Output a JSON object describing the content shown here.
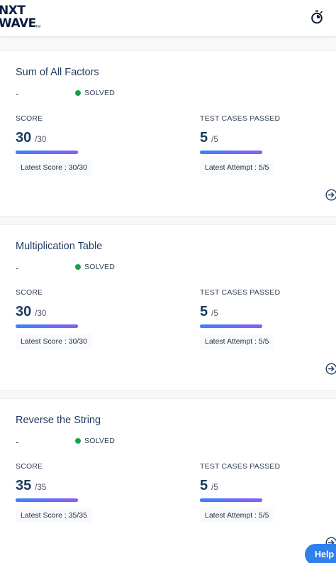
{
  "app": {
    "logo_line1": "NXT",
    "logo_line2": "WAVE",
    "logo_mark": "TM",
    "timer_icon": "stopwatch-icon"
  },
  "problems": [
    {
      "title": "Sum of All Factors",
      "difficulty": "-",
      "status": "SOLVED",
      "score_label": "SCORE",
      "score": "30",
      "score_total": "/30",
      "score_progress_percent": 100,
      "tests_label": "TEST CASES PASSED",
      "tests": "5",
      "tests_total": "/5",
      "tests_progress_percent": 100,
      "latest_score": "Latest Score : 30/30",
      "latest_attempt": "Latest Attempt : 5/5"
    },
    {
      "title": "Multiplication Table",
      "difficulty": "-",
      "status": "SOLVED",
      "score_label": "SCORE",
      "score": "30",
      "score_total": "/30",
      "score_progress_percent": 100,
      "tests_label": "TEST CASES PASSED",
      "tests": "5",
      "tests_total": "/5",
      "tests_progress_percent": 100,
      "latest_score": "Latest Score : 30/30",
      "latest_attempt": "Latest Attempt : 5/5"
    },
    {
      "title": "Reverse the String",
      "difficulty": "-",
      "status": "SOLVED",
      "score_label": "SCORE",
      "score": "35",
      "score_total": "/35",
      "score_progress_percent": 100,
      "tests_label": "TEST CASES PASSED",
      "tests": "5",
      "tests_total": "/5",
      "tests_progress_percent": 100,
      "latest_score": "Latest Score : 35/35",
      "latest_attempt": "Latest Attempt : 5/5"
    }
  ],
  "help": {
    "label": "Help"
  },
  "colors": {
    "solved_dot": "#16a34a",
    "progress_start": "#3b82f6",
    "progress_end": "#8b5cf6",
    "help_button": "#2f80ed"
  }
}
